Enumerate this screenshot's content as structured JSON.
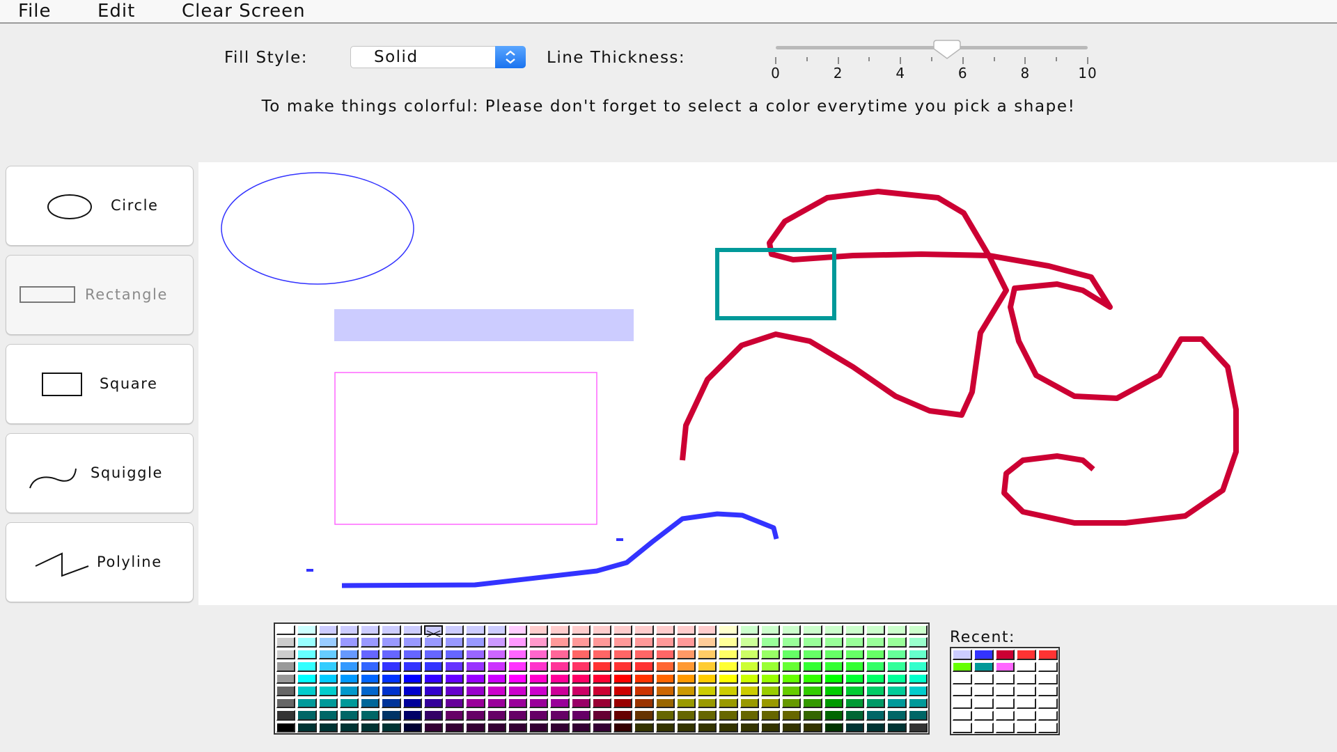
{
  "menu": {
    "items": [
      "File",
      "Edit",
      "Clear Screen"
    ]
  },
  "controls": {
    "fill_style_label": "Fill Style:",
    "fill_style_value": "Solid",
    "line_thickness_label": "Line Thickness:",
    "line_thickness": {
      "min": 0,
      "max": 10,
      "value": 5.5,
      "major_tick_labels": [
        "0",
        "2",
        "4",
        "6",
        "8",
        "10"
      ],
      "minor_tick_step": 1
    }
  },
  "hint_text": "To make things colorful: Please don't forget to select a color everytime you pick a shape!",
  "tools": [
    {
      "label": "Circle",
      "icon": "circle-icon",
      "enabled": true
    },
    {
      "label": "Rectangle",
      "icon": "rectangle-icon",
      "enabled": false
    },
    {
      "label": "Square",
      "icon": "square-icon",
      "enabled": true
    },
    {
      "label": "Squiggle",
      "icon": "squiggle-icon",
      "enabled": true
    },
    {
      "label": "Polyline",
      "icon": "polyline-icon",
      "enabled": true
    }
  ],
  "canvas_shapes": [
    {
      "type": "circle",
      "color": "#3333ff",
      "fill": false
    },
    {
      "type": "rectangle",
      "color": "#ccccff",
      "fill": true
    },
    {
      "type": "rectangle",
      "color": "#ff66ff",
      "fill": false
    },
    {
      "type": "square",
      "color": "#009999",
      "fill": false
    },
    {
      "type": "squiggle",
      "color": "#3333ff"
    },
    {
      "type": "squiggle",
      "color": "#cc0033"
    }
  ],
  "palette": {
    "columns": 31,
    "rows": 9,
    "selected": {
      "row": 0,
      "col": 7
    },
    "colors": [
      [
        "#ffffff",
        "#ccffff",
        "#ccccff",
        "#ccccff",
        "#ccccff",
        "#ccccff",
        "#ccccff",
        "#ccccff",
        "#ccccff",
        "#ccccff",
        "#ccccff",
        "#ffccff",
        "#ffcccc",
        "#ffcccc",
        "#ffcccc",
        "#ffcccc",
        "#ffcccc",
        "#ffcccc",
        "#ffcccc",
        "#ffcccc",
        "#ffcccc",
        "#ffffcc",
        "#ccffcc",
        "#ccffcc",
        "#ccffcc",
        "#ccffcc",
        "#ccffcc",
        "#ccffcc",
        "#ccffcc",
        "#ccffcc",
        "#ccffcc"
      ],
      [
        "#cccccc",
        "#99ffff",
        "#99ccff",
        "#9999ff",
        "#9999ff",
        "#9999ff",
        "#9999ff",
        "#9999ff",
        "#9999ff",
        "#9999ff",
        "#cc99ff",
        "#ff99ff",
        "#ff99cc",
        "#ff9999",
        "#ff9999",
        "#ff9999",
        "#ff9999",
        "#ff9999",
        "#ff9999",
        "#ff9999",
        "#ffcc99",
        "#ffff99",
        "#ccff99",
        "#99ff99",
        "#99ff99",
        "#99ff99",
        "#99ff99",
        "#99ff99",
        "#99ff99",
        "#99ff99",
        "#99ffcc"
      ],
      [
        "#cccccc",
        "#66ffff",
        "#66ccff",
        "#6699ff",
        "#6666ff",
        "#6666ff",
        "#6666ff",
        "#6666ff",
        "#6666ff",
        "#9966ff",
        "#cc66ff",
        "#ff66ff",
        "#ff66cc",
        "#ff6699",
        "#ff6666",
        "#ff6666",
        "#ff6666",
        "#ff6666",
        "#ff6666",
        "#ff9966",
        "#ffcc66",
        "#ffff66",
        "#ccff66",
        "#99ff66",
        "#66ff66",
        "#66ff66",
        "#66ff66",
        "#66ff66",
        "#66ff66",
        "#66ff99",
        "#66ffcc"
      ],
      [
        "#999999",
        "#33ffff",
        "#33ccff",
        "#3399ff",
        "#3366ff",
        "#3333ff",
        "#3333ff",
        "#3333ff",
        "#6633ff",
        "#9933ff",
        "#cc33ff",
        "#ff33ff",
        "#ff33cc",
        "#ff3399",
        "#ff3366",
        "#ff3333",
        "#ff3333",
        "#ff3333",
        "#ff6633",
        "#ff9933",
        "#ffcc33",
        "#ffff33",
        "#ccff33",
        "#99ff33",
        "#66ff33",
        "#33ff33",
        "#33ff33",
        "#33ff33",
        "#33ff66",
        "#33ff99",
        "#33ffcc"
      ],
      [
        "#999999",
        "#00ffff",
        "#00ccff",
        "#0099ff",
        "#0066ff",
        "#0033ff",
        "#0000ff",
        "#3300ff",
        "#6600ff",
        "#9900ff",
        "#cc00ff",
        "#ff00ff",
        "#ff00cc",
        "#ff0099",
        "#ff0066",
        "#ff0033",
        "#ff0000",
        "#ff3300",
        "#ff6600",
        "#ff9900",
        "#ffcc00",
        "#ffff00",
        "#ccff00",
        "#99ff00",
        "#66ff00",
        "#33ff00",
        "#00ff00",
        "#00ff33",
        "#00ff66",
        "#00ff99",
        "#00ffcc"
      ],
      [
        "#666666",
        "#00cccc",
        "#00cccc",
        "#0099cc",
        "#0066cc",
        "#0033cc",
        "#0000cc",
        "#3300cc",
        "#6600cc",
        "#9900cc",
        "#cc00cc",
        "#cc00cc",
        "#cc00cc",
        "#cc0099",
        "#cc0066",
        "#cc0033",
        "#cc0000",
        "#cc3300",
        "#cc6600",
        "#cc9900",
        "#cccc00",
        "#cccc00",
        "#cccc00",
        "#99cc00",
        "#66cc00",
        "#33cc00",
        "#00cc00",
        "#00cc33",
        "#00cc66",
        "#00cc99",
        "#00cccc"
      ],
      [
        "#666666",
        "#009999",
        "#009999",
        "#009999",
        "#006699",
        "#003399",
        "#000099",
        "#330099",
        "#660099",
        "#990099",
        "#990099",
        "#990099",
        "#990099",
        "#990099",
        "#990066",
        "#990033",
        "#990000",
        "#993300",
        "#996600",
        "#999900",
        "#999900",
        "#999900",
        "#999900",
        "#999900",
        "#669900",
        "#339900",
        "#009900",
        "#009933",
        "#009966",
        "#009999",
        "#009999"
      ],
      [
        "#333333",
        "#006666",
        "#006666",
        "#006666",
        "#006666",
        "#003366",
        "#000066",
        "#330066",
        "#660066",
        "#660066",
        "#660066",
        "#660066",
        "#660066",
        "#660066",
        "#660066",
        "#660033",
        "#660000",
        "#663300",
        "#666600",
        "#666600",
        "#666600",
        "#666600",
        "#666600",
        "#666600",
        "#666600",
        "#336600",
        "#006600",
        "#006633",
        "#006666",
        "#006666",
        "#006666"
      ],
      [
        "#000000",
        "#003333",
        "#003333",
        "#003333",
        "#003333",
        "#003333",
        "#000033",
        "#330033",
        "#330033",
        "#330033",
        "#330033",
        "#330033",
        "#330033",
        "#330033",
        "#330033",
        "#330033",
        "#330000",
        "#333300",
        "#333300",
        "#333300",
        "#333300",
        "#333300",
        "#333300",
        "#333300",
        "#333300",
        "#333300",
        "#003300",
        "#003333",
        "#003333",
        "#003333",
        "#333333"
      ]
    ]
  },
  "recent": {
    "label": "Recent:",
    "columns": 5,
    "rows": 7,
    "colors": [
      "#ccccff",
      "#3333ff",
      "#cc0033",
      "#ff3333",
      "#ff3333",
      "#66ff00",
      "#009999",
      "#ff66ff"
    ]
  }
}
